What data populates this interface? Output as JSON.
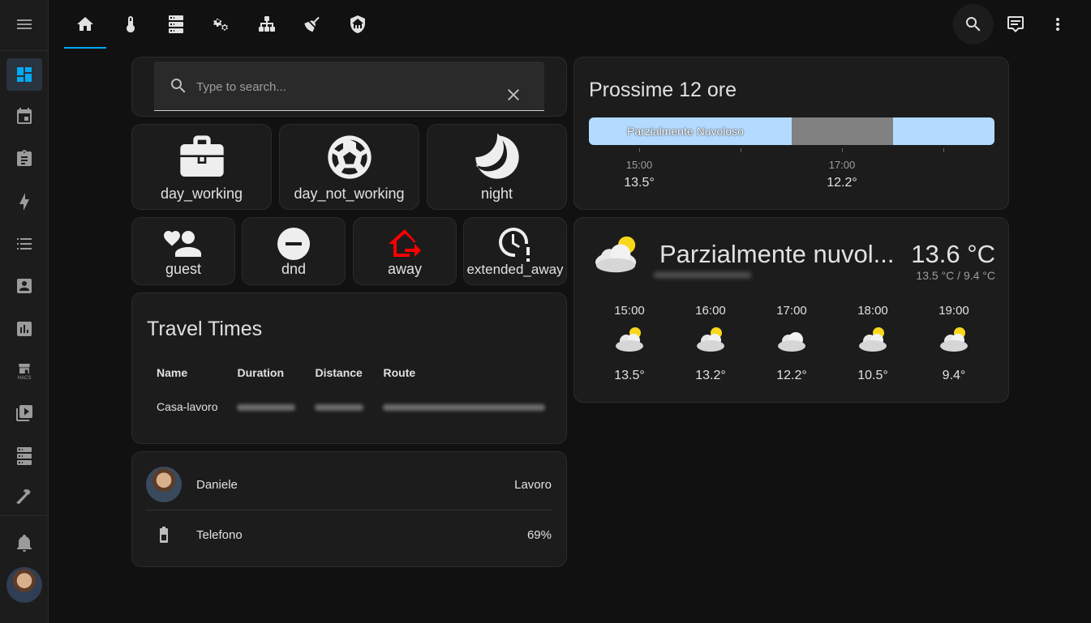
{
  "topbar": {
    "tabs": [
      "home-icon",
      "thermometer-icon",
      "server-icon",
      "cogs-icon",
      "network-icon",
      "broom-icon",
      "shield-home-icon"
    ],
    "right": [
      "search-icon",
      "assist-icon",
      "more-icon"
    ]
  },
  "sidebar": {
    "items": [
      "menu-icon",
      "dashboard-icon",
      "calendar-icon",
      "clipboard-icon",
      "lightning-icon",
      "list-icon",
      "account-box-icon",
      "chart-icon",
      "hacs-icon",
      "media-icon",
      "server-icon",
      "hammer-icon",
      "bell-icon"
    ],
    "hacs_text": "HACS"
  },
  "search": {
    "placeholder": "Type to search..."
  },
  "modes_row1": [
    {
      "label": "day_working",
      "icon": "briefcase-icon"
    },
    {
      "label": "day_not_working",
      "icon": "soccer-icon"
    },
    {
      "label": "night",
      "icon": "moon-icon"
    }
  ],
  "modes_row2": [
    {
      "label": "guest",
      "icon": "account-heart-icon"
    },
    {
      "label": "dnd",
      "icon": "minus-circle-icon"
    },
    {
      "label": "away",
      "icon": "home-export-icon",
      "color": "#ff0000"
    },
    {
      "label": "extended_away",
      "icon": "clock-alert-icon"
    }
  ],
  "travel": {
    "title": "Travel Times",
    "headers": [
      "Name",
      "Duration",
      "Distance",
      "Route"
    ],
    "rows": [
      {
        "name": "Casa-lavoro"
      }
    ]
  },
  "entities": [
    {
      "name": "Daniele",
      "value": "Lavoro"
    },
    {
      "name": "Telefono",
      "value": "69%"
    }
  ],
  "hourly": {
    "title": "Prossime 12 ore",
    "condition_label": "Parzialmente Nuvoloso",
    "ticks": [
      {
        "time": "15:00",
        "temp": "13.5°"
      },
      {
        "time": "17:00",
        "temp": "12.2°"
      }
    ],
    "colors": {
      "cloudy_light": "#b3dbff",
      "cloudy_dark": "#818181"
    }
  },
  "weather": {
    "condition": "Parzialmente nuvol...",
    "temperature": "13.6 °C",
    "range": "13.5 °C / 9.4 °C",
    "forecast": [
      {
        "time": "15:00",
        "temp": "13.5°",
        "icon": "partly-cloudy-icon"
      },
      {
        "time": "16:00",
        "temp": "13.2°",
        "icon": "partly-cloudy-icon"
      },
      {
        "time": "17:00",
        "temp": "12.2°",
        "icon": "cloudy-icon"
      },
      {
        "time": "18:00",
        "temp": "10.5°",
        "icon": "partly-cloudy-icon"
      },
      {
        "time": "19:00",
        "temp": "9.4°",
        "icon": "partly-cloudy-icon"
      }
    ]
  },
  "theme": {
    "accent": "#03a9f4",
    "card": "#1c1c1c",
    "background": "#111111"
  }
}
